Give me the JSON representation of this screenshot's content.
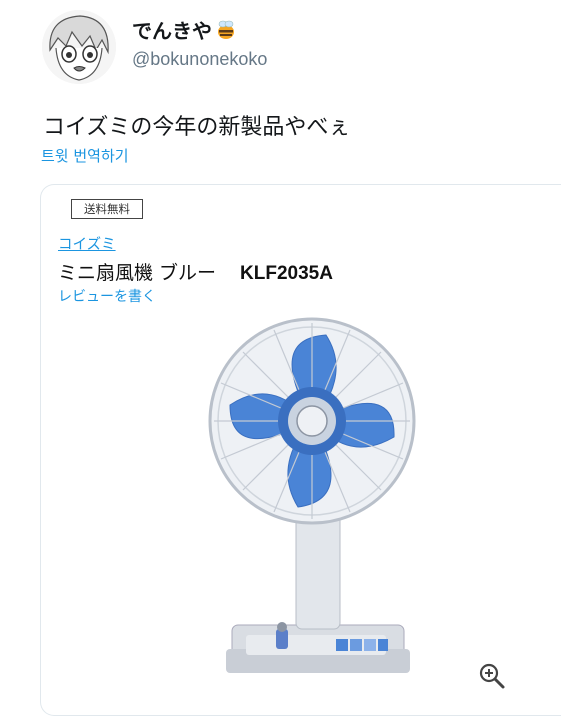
{
  "user": {
    "display_name": "でんきや",
    "name_emoji": "bee-icon",
    "handle": "@bokunonekoko"
  },
  "tweet": {
    "text": "コイズミの今年の新製品やべぇ",
    "translate_label": "트윗 번역하기"
  },
  "card": {
    "badge": "送料無料",
    "brand": "コイズミ",
    "product_name": "ミニ扇風機 ブルー",
    "model": "KLF2035A",
    "review_link": "レビューを書く",
    "image": "blue-electric-fan",
    "zoom_icon": "zoom-in-icon"
  },
  "colors": {
    "link": "#1b95e0",
    "fan_blue": "#4a84d6",
    "text": "#14171a",
    "muted": "#657786"
  }
}
